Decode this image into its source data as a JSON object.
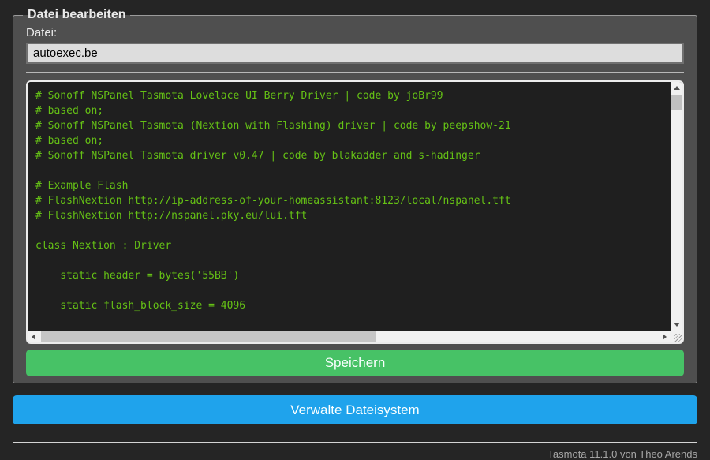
{
  "file_editor": {
    "legend": "Datei bearbeiten",
    "file_label": "Datei:",
    "file_name": "autoexec.be",
    "save_button_label": "Speichern"
  },
  "editor": {
    "content": "# Sonoff NSPanel Tasmota Lovelace UI Berry Driver | code by joBr99\n# based on;\n# Sonoff NSPanel Tasmota (Nextion with Flashing) driver | code by peepshow-21\n# based on;\n# Sonoff NSPanel Tasmota driver v0.47 | code by blakadder and s-hadinger\n\n# Example Flash\n# FlashNextion http://ip-address-of-your-homeassistant:8123/local/nspanel.tft\n# FlashNextion http://nspanel.pky.eu/lui.tft\n\nclass Nextion : Driver\n\n    static header = bytes('55BB')\n\n    static flash_block_size = 4096"
  },
  "actions": {
    "manage_filesystem_label": "Verwalte Dateisystem"
  },
  "footer": {
    "version_text": "Tasmota 11.1.0 von Theo Arends"
  },
  "icons": {
    "scroll_up_arrow": "triangle-up",
    "scroll_down_arrow": "triangle-down",
    "scroll_left_arrow": "triangle-left",
    "scroll_right_arrow": "triangle-right",
    "resize_grip": "diagonal-lines"
  },
  "colors": {
    "page_background": "#252525",
    "form_background": "#4f4f4f",
    "text": "#eaeaea",
    "input_background": "#dddddd",
    "input_text": "#000000",
    "editor_background": "#1f1f1f",
    "editor_text": "#65c115",
    "save_button": "#47c266",
    "manage_button": "#1fa3ec",
    "button_text": "#faffff",
    "footer_text": "#a6a6a6"
  }
}
